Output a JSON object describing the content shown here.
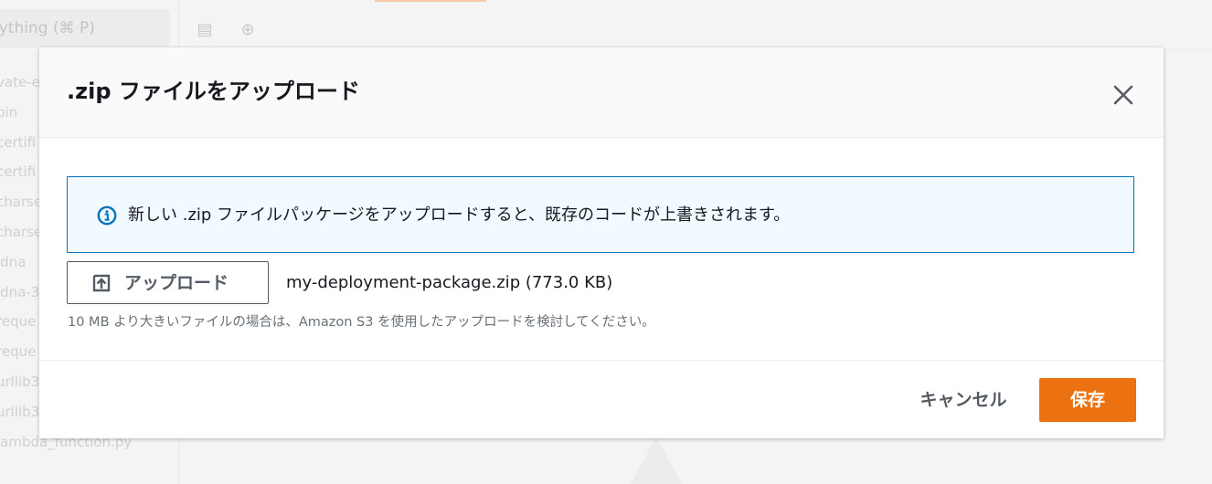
{
  "background": {
    "search_placeholder": "nything (⌘ P)",
    "file_tree": [
      "vate-e",
      "bin",
      "certifi",
      "certifi",
      "charse",
      "charse",
      "idna",
      "idna-3",
      "reque",
      "reque",
      "urllib3",
      "urllib3",
      "lambda_function.py"
    ]
  },
  "modal": {
    "title": ".zip ファイルをアップロード",
    "close_icon": "close-icon",
    "info": {
      "icon": "info-icon",
      "text": "新しい .zip ファイルパッケージをアップロードすると、既存のコードが上書きされます。"
    },
    "upload": {
      "icon": "upload-icon",
      "label": "アップロード"
    },
    "selected_file": "my-deployment-package.zip (773.0 KB)",
    "hint": "10 MB より大きいファイルの場合は、Amazon S3 を使用したアップロードを検討してください。",
    "footer": {
      "cancel_label": "キャンセル",
      "save_label": "保存"
    }
  },
  "colors": {
    "accent": "#ec7211",
    "info_border": "#0073bb",
    "info_background": "#f1faff",
    "text_primary": "#16191f",
    "text_secondary": "#687078",
    "button_text": "#545b64"
  }
}
